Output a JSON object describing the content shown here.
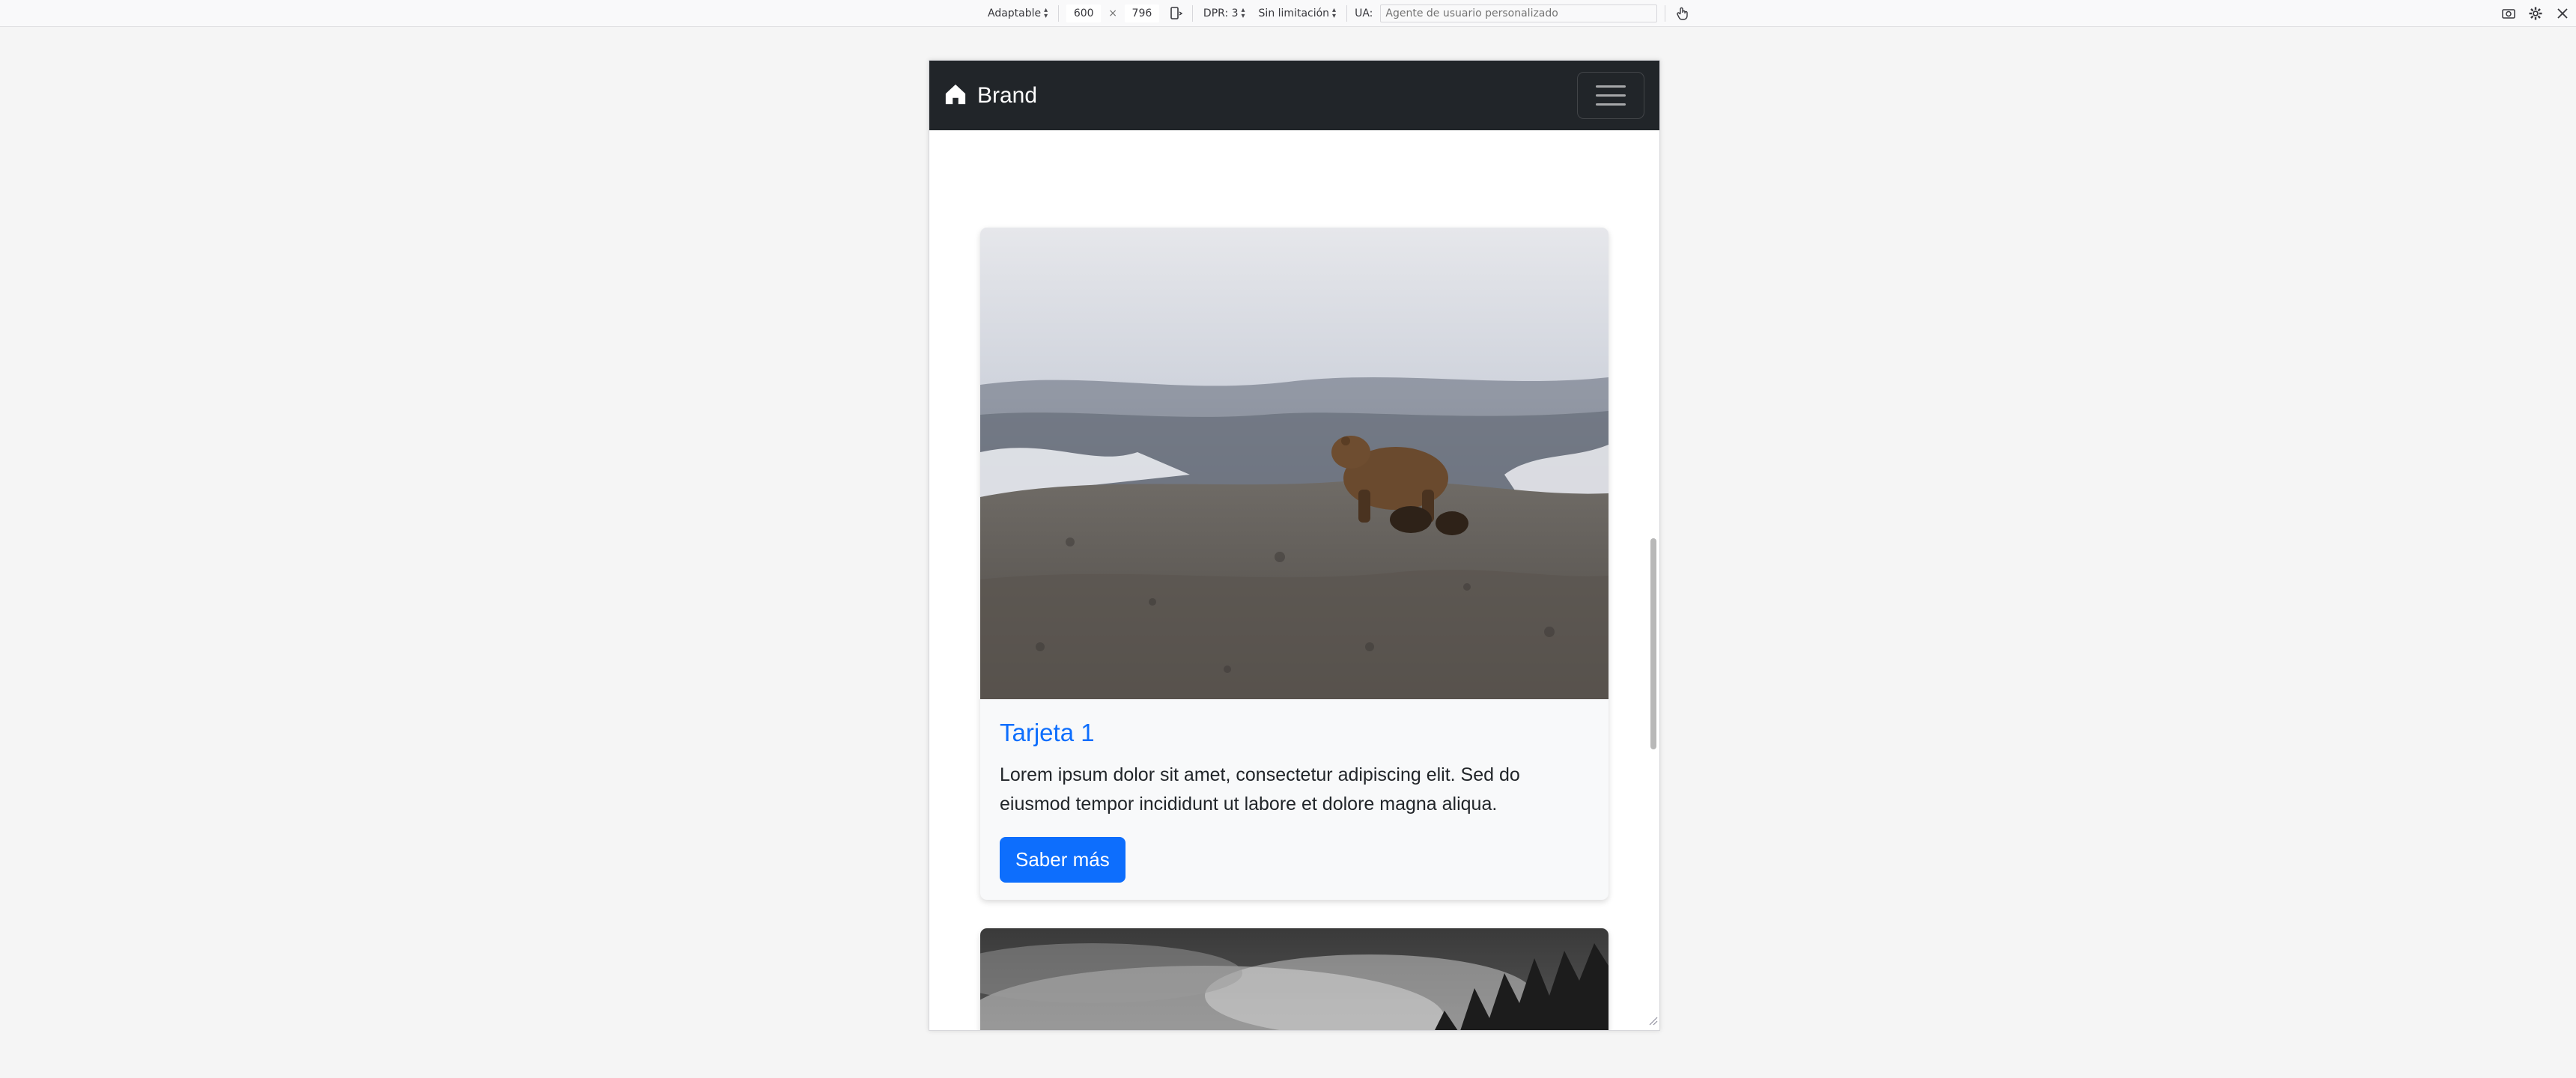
{
  "toolbar": {
    "device": "Adaptable",
    "width": "600",
    "separator": "×",
    "height": "796",
    "dpr": "DPR: 3",
    "throttling": "Sin limitación",
    "ua_label": "UA:",
    "ua_placeholder": "Agente de usuario personalizado"
  },
  "navbar": {
    "brand": "Brand",
    "background": "#212529"
  },
  "cards": [
    {
      "title": "Tarjeta 1",
      "text": "Lorem ipsum dolor sit amet, consectetur adipiscing elit. Sed do eiusmod tempor incididunt ut labore et dolore magna aliqua.",
      "button": "Saber más",
      "image": "bear-on-rocky-hill-photo"
    },
    {
      "image": "foggy-forest-photo"
    }
  ],
  "colors": {
    "primary": "#0d6efd",
    "card_bg": "#f8f9fa",
    "page_bg": "#f5f5f5"
  },
  "icons": [
    "home-icon",
    "menu-icon",
    "rotate-icon",
    "touch-icon",
    "screenshot-icon",
    "settings-icon",
    "close-icon"
  ]
}
